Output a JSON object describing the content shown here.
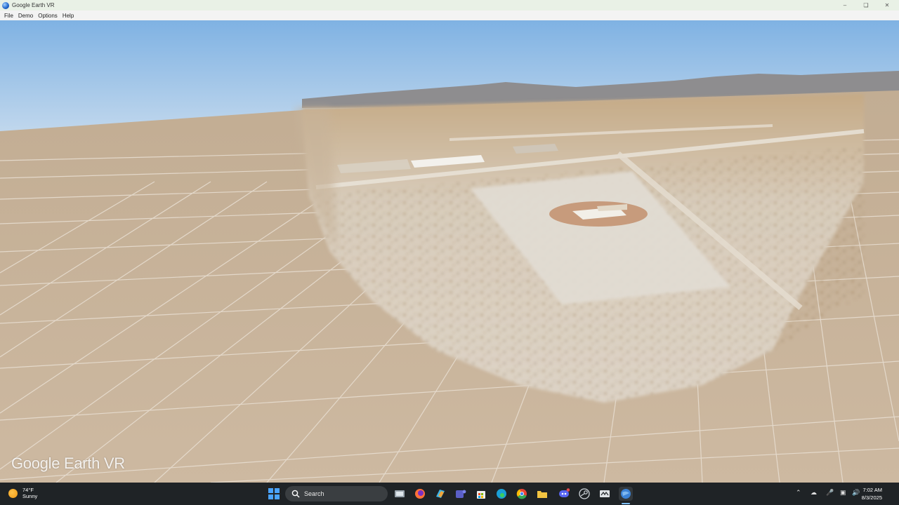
{
  "window": {
    "title": "Google Earth VR"
  },
  "menu": [
    "File",
    "Demo",
    "Options",
    "Help"
  ],
  "viewport": {
    "watermark": "Google Earth VR"
  },
  "taskbar": {
    "weather": {
      "temp": "74°F",
      "condition": "Sunny"
    },
    "search_placeholder": "Search",
    "clock": {
      "time": "7:02 AM",
      "date": "8/3/2025"
    },
    "pinned_icons": [
      "windows-start-icon",
      "search-icon",
      "task-view-icon",
      "firefox-icon",
      "copilot-icon",
      "teams-icon",
      "store-icon",
      "edge-icon",
      "chrome-icon",
      "file-explorer-icon",
      "discord-icon",
      "steam-icon",
      "vr-headset-icon",
      "google-earth-icon"
    ],
    "tray_icons": [
      "chevron-up-icon",
      "onedrive-icon",
      "microphone-icon",
      "network-icon",
      "volume-icon"
    ]
  },
  "colors": {
    "sky_top": "#7fb2e3",
    "ground": "#c7b39a",
    "taskbar": "#1f2326",
    "accent": "#7fc1ff"
  }
}
